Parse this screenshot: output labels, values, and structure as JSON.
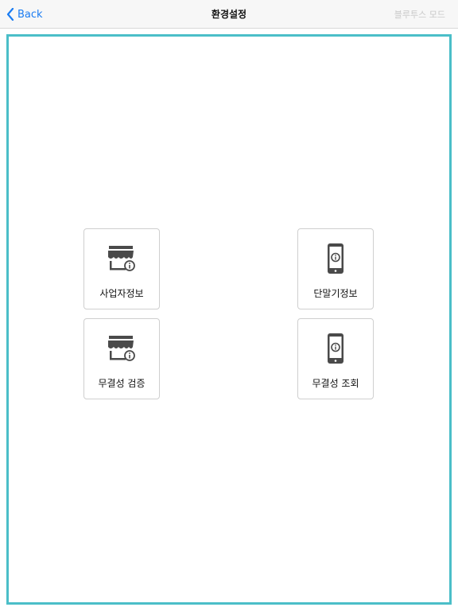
{
  "navbar": {
    "back_label": "Back",
    "title": "환경설정",
    "right_label": "블루투스 모드"
  },
  "tiles": [
    {
      "label": "사업자정보",
      "icon": "store-info-icon"
    },
    {
      "label": "단말기정보",
      "icon": "phone-info-icon"
    },
    {
      "label": "무결성 검증",
      "icon": "store-info-icon"
    },
    {
      "label": "무결성 조회",
      "icon": "phone-info-icon"
    }
  ],
  "colors": {
    "accent": "#1a7cf2",
    "frame": "#4bbec8",
    "icon": "#4a4a4a"
  }
}
